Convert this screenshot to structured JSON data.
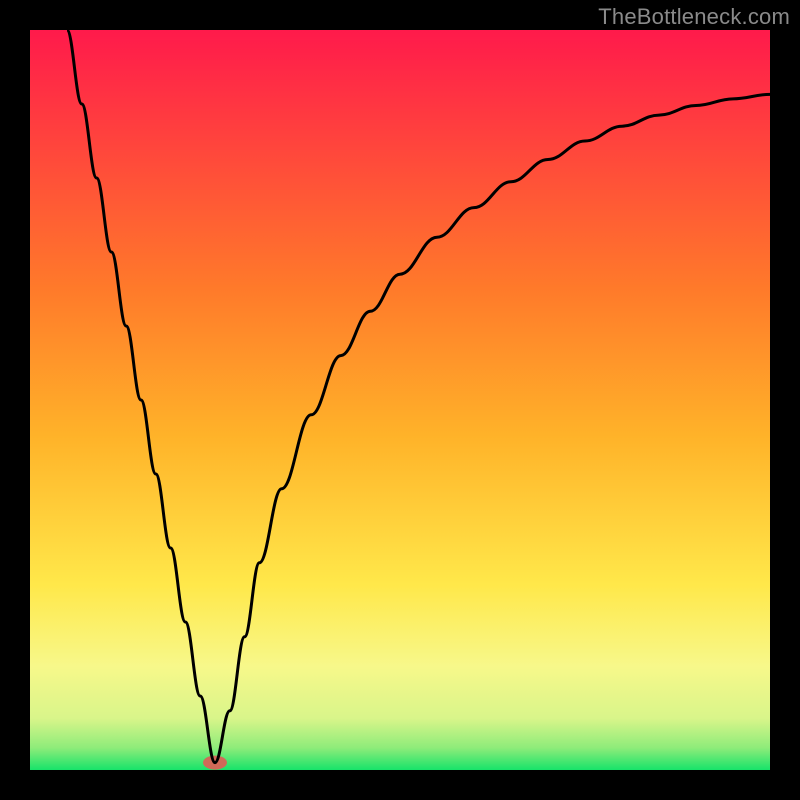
{
  "watermark": "TheBottleneck.com",
  "chart_data": {
    "type": "line",
    "title": "",
    "xlabel": "",
    "ylabel": "",
    "xlim": [
      0,
      100
    ],
    "ylim": [
      0,
      100
    ],
    "grid": false,
    "legend": false,
    "gradient_stops": [
      {
        "offset": 0.0,
        "color": "#ff1a4b"
      },
      {
        "offset": 0.35,
        "color": "#ff7a2a"
      },
      {
        "offset": 0.55,
        "color": "#ffb329"
      },
      {
        "offset": 0.75,
        "color": "#ffe84a"
      },
      {
        "offset": 0.86,
        "color": "#f7f88a"
      },
      {
        "offset": 0.93,
        "color": "#d9f58a"
      },
      {
        "offset": 0.97,
        "color": "#8eec7a"
      },
      {
        "offset": 1.0,
        "color": "#17e36a"
      }
    ],
    "marker": {
      "x": 25,
      "y": 1,
      "color": "#d06a58",
      "rx": 12,
      "ry": 7
    },
    "series": [
      {
        "name": "curve",
        "color": "#000000",
        "x": [
          5,
          7,
          9,
          11,
          13,
          15,
          17,
          19,
          21,
          23,
          25,
          27,
          29,
          31,
          34,
          38,
          42,
          46,
          50,
          55,
          60,
          65,
          70,
          75,
          80,
          85,
          90,
          95,
          100
        ],
        "y": [
          100,
          90,
          80,
          70,
          60,
          50,
          40,
          30,
          20,
          10,
          1,
          8,
          18,
          28,
          38,
          48,
          56,
          62,
          67,
          72,
          76,
          79.5,
          82.5,
          85,
          87,
          88.5,
          89.8,
          90.7,
          91.3
        ]
      }
    ]
  }
}
